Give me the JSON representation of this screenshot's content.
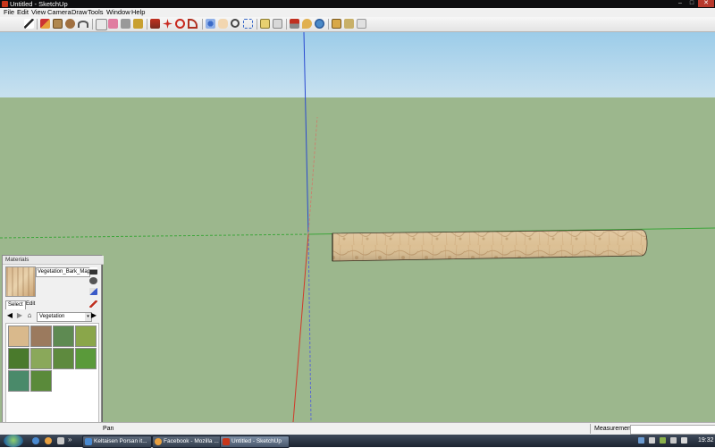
{
  "window": {
    "title": "Untitled - SketchUp",
    "min": "–",
    "max": "□",
    "close": "✕"
  },
  "menu": [
    "File",
    "Edit",
    "View",
    "Camera",
    "Draw",
    "Tools",
    "Window",
    "Help"
  ],
  "toolbar": {
    "icons": [
      "select-icon",
      "pencil-icon",
      "rectangle-icon",
      "circle-icon",
      "arc-icon",
      "make-component-icon",
      "eraser-icon",
      "tape-measure-icon",
      "paint-bucket-icon",
      "push-pull-icon",
      "move-icon",
      "rotate-icon",
      "offset-icon",
      "orbit-icon",
      "pan-icon",
      "zoom-icon",
      "zoom-extents-icon",
      "get-models-icon",
      "share-model-icon",
      "place-model-icon",
      "add-location-icon",
      "google-earth-icon",
      "components-icon",
      "materials-icon",
      "styles-icon"
    ]
  },
  "materials": {
    "title": "Materials",
    "name": "Vegetation_Bark_Maple",
    "tabs": {
      "select": "Select",
      "edit": "Edit"
    },
    "nav": {
      "back": "◀",
      "forward": "▶",
      "home": "⌂",
      "details": "▶"
    },
    "collection": "Vegetation",
    "dropdown_arrow": "▾",
    "swatch_colors": [
      "#d9b98c",
      "#9b7a5e",
      "#5e8a52",
      "#8aa64a",
      "#4a7a2c",
      "#8aa85a",
      "#5e8a3e",
      "#5a9a3a",
      "#4a8a6a",
      "#5a8a3a"
    ]
  },
  "status": {
    "text": "Pan",
    "measurements_label": "Measurements"
  },
  "taskbar": {
    "quick_launch_more": "»",
    "tasks": [
      "Keltaisen Porsan it...",
      "Facebook - Mozilla ...",
      "Untitled - SketchUp"
    ],
    "clock": "19:32"
  },
  "colors": {
    "sky": "#a9d1ea",
    "ground": "#9cb78d",
    "red_axis": "#d03a2a",
    "green_axis": "#3ca53a",
    "blue_axis": "#2a4ad0",
    "bark": "#dcc094"
  }
}
